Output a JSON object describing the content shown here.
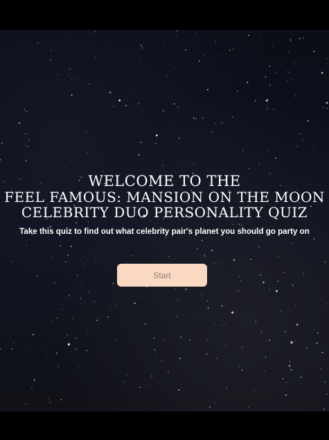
{
  "page": {
    "title_lines": [
      "WELCOME TO THE",
      "FEEL FAMOUS: MANSION ON THE MOON",
      "CELEBRITY DUO PERSONALITY QUIZ"
    ],
    "subtitle": "Take this quiz to find out what celebrity pair's planet you should go party on",
    "start_button_label": "Start"
  },
  "colors": {
    "background": "#000000",
    "starfield": "#0e1120",
    "text": "#ffffff",
    "button_bg": "#f9d9c2",
    "button_text": "#8a7d74"
  }
}
